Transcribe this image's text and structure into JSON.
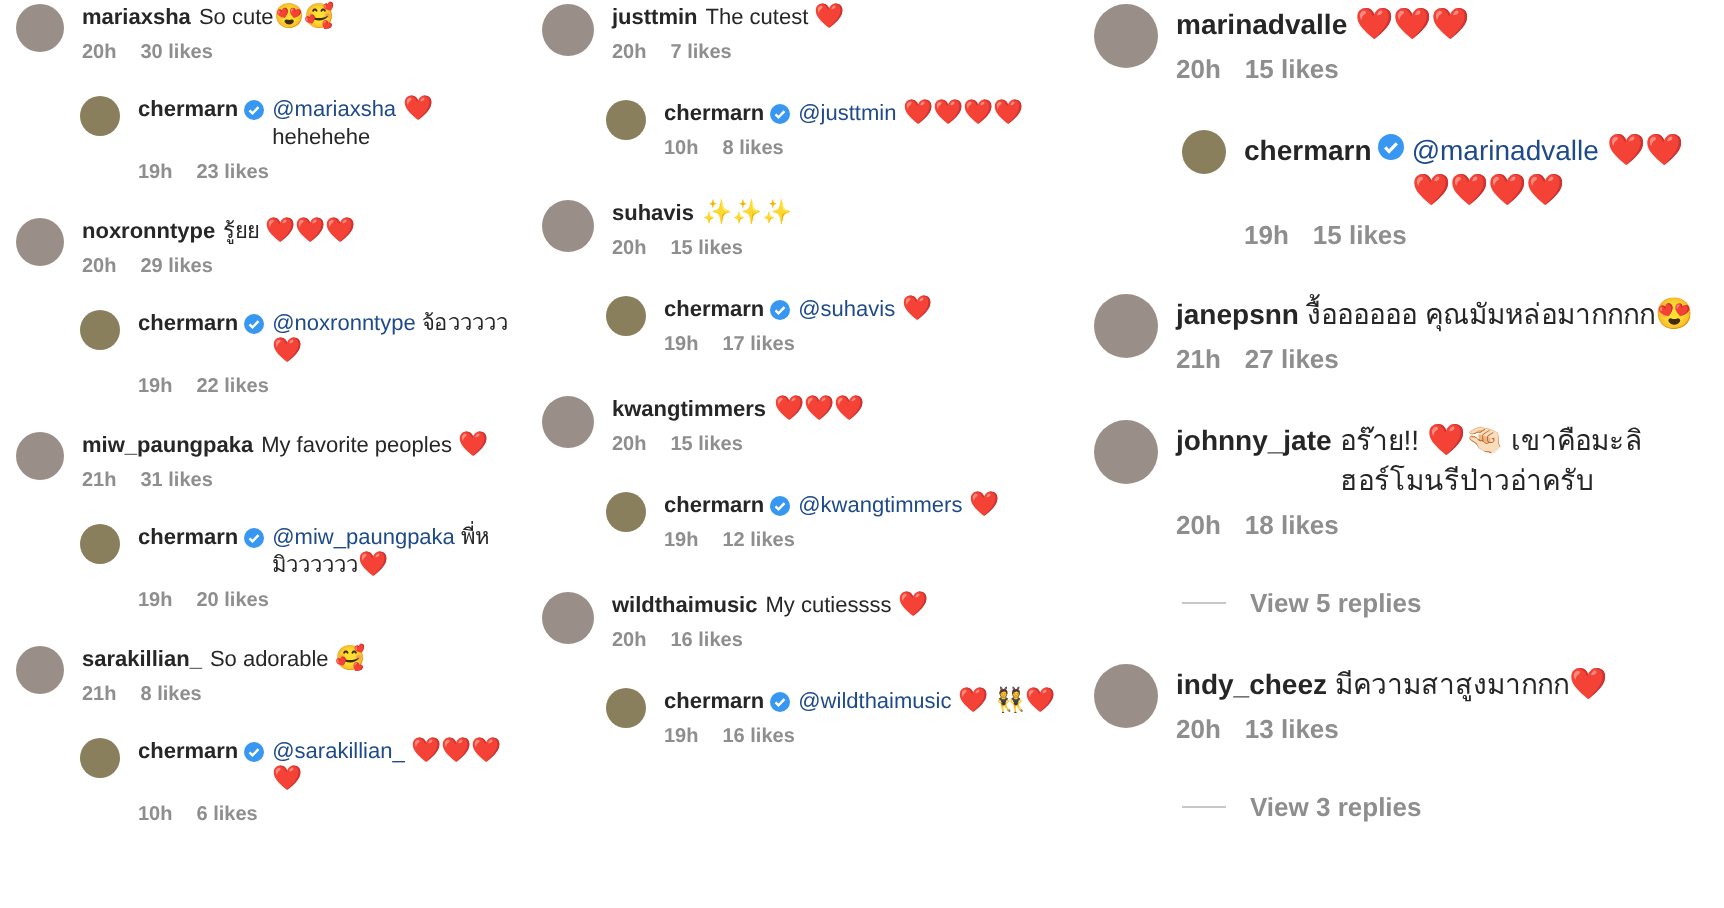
{
  "columns": [
    {
      "threads": [
        {
          "user": "mariaxsha",
          "segments": [
            {
              "kind": "text",
              "text": "So cute"
            },
            {
              "kind": "emoji",
              "text": "😍🥰"
            }
          ],
          "time": "20h",
          "likes": "30 likes",
          "reply": {
            "user": "chermarn",
            "verified": true,
            "segments": [
              {
                "kind": "mention",
                "text": "@mariaxsha"
              },
              {
                "kind": "emoji",
                "text": " ❤️"
              },
              {
                "kind": "text",
                "text": " hehehehe"
              }
            ],
            "time": "19h",
            "likes": "23 likes"
          }
        },
        {
          "user": "noxronntype",
          "segments": [
            {
              "kind": "text",
              "text": "รู้ยย "
            },
            {
              "kind": "emoji",
              "text": "❤️❤️❤️"
            }
          ],
          "time": "20h",
          "likes": "29 likes",
          "reply": {
            "user": "chermarn",
            "verified": true,
            "segments": [
              {
                "kind": "mention",
                "text": "@noxronntype"
              },
              {
                "kind": "text",
                "text": " จ้อววววว"
              },
              {
                "kind": "emoji",
                "text": " ❤️"
              }
            ],
            "time": "19h",
            "likes": "22 likes"
          }
        },
        {
          "user": "miw_paungpaka",
          "segments": [
            {
              "kind": "text",
              "text": "My favorite peoples "
            },
            {
              "kind": "emoji",
              "text": "❤️"
            }
          ],
          "time": "21h",
          "likes": "31 likes",
          "reply": {
            "user": "chermarn",
            "verified": true,
            "segments": [
              {
                "kind": "mention",
                "text": "@miw_paungpaka"
              },
              {
                "kind": "text",
                "text": " พี่หมิวววววว"
              },
              {
                "kind": "emoji",
                "text": "❤️"
              }
            ],
            "time": "19h",
            "likes": "20 likes"
          }
        },
        {
          "user": "sarakillian_",
          "segments": [
            {
              "kind": "text",
              "text": "So adorable "
            },
            {
              "kind": "emoji",
              "text": "🥰"
            }
          ],
          "time": "21h",
          "likes": "8 likes",
          "reply": {
            "user": "chermarn",
            "verified": true,
            "segments": [
              {
                "kind": "mention",
                "text": "@sarakillian_"
              },
              {
                "kind": "emoji",
                "text": " ❤️❤️❤️❤️"
              }
            ],
            "time": "10h",
            "likes": "6 likes"
          }
        }
      ]
    },
    {
      "threads": [
        {
          "user": "justtmin",
          "segments": [
            {
              "kind": "text",
              "text": "The cutest "
            },
            {
              "kind": "emoji",
              "text": "❤️"
            }
          ],
          "time": "20h",
          "likes": "7 likes",
          "reply": {
            "user": "chermarn",
            "verified": true,
            "segments": [
              {
                "kind": "mention",
                "text": "@justtmin"
              },
              {
                "kind": "emoji",
                "text": " ❤️❤️❤️❤️"
              }
            ],
            "time": "10h",
            "likes": "8 likes"
          }
        },
        {
          "user": "suhavis",
          "segments": [
            {
              "kind": "emoji",
              "text": "✨✨✨"
            }
          ],
          "time": "20h",
          "likes": "15 likes",
          "reply": {
            "user": "chermarn",
            "verified": true,
            "segments": [
              {
                "kind": "mention",
                "text": "@suhavis"
              },
              {
                "kind": "emoji",
                "text": " ❤️"
              }
            ],
            "time": "19h",
            "likes": "17 likes"
          }
        },
        {
          "user": "kwangtimmers",
          "segments": [
            {
              "kind": "emoji",
              "text": "❤️❤️❤️"
            }
          ],
          "time": "20h",
          "likes": "15 likes",
          "reply": {
            "user": "chermarn",
            "verified": true,
            "segments": [
              {
                "kind": "mention",
                "text": "@kwangtimmers"
              },
              {
                "kind": "emoji",
                "text": " ❤️"
              }
            ],
            "time": "19h",
            "likes": "12 likes"
          }
        },
        {
          "user": "wildthaimusic",
          "segments": [
            {
              "kind": "text",
              "text": "My cutiessss "
            },
            {
              "kind": "emoji",
              "text": "❤️"
            }
          ],
          "time": "20h",
          "likes": "16 likes",
          "reply": {
            "user": "chermarn",
            "verified": true,
            "segments": [
              {
                "kind": "mention",
                "text": "@wildthaimusic"
              },
              {
                "kind": "emoji",
                "text": " ❤️ 👯❤️"
              }
            ],
            "time": "19h",
            "likes": "16 likes"
          }
        }
      ]
    },
    {
      "threads": [
        {
          "user": "marinadvalle",
          "segments": [
            {
              "kind": "emoji",
              "text": "❤️❤️❤️"
            }
          ],
          "time": "20h",
          "likes": "15 likes",
          "reply": {
            "user": "chermarn",
            "verified": true,
            "segments": [
              {
                "kind": "mention",
                "text": "@marinadvalle"
              },
              {
                "kind": "emoji",
                "text": " ❤️❤️❤️❤️❤️❤️"
              }
            ],
            "time": "19h",
            "likes": "15 likes"
          }
        },
        {
          "user": "janepsnn",
          "segments": [
            {
              "kind": "text",
              "text": "งื้ออออออ คุณมัมหล่อมากกกก"
            },
            {
              "kind": "emoji",
              "text": "😍"
            }
          ],
          "time": "21h",
          "likes": "27 likes"
        },
        {
          "user": "johnny_jate",
          "segments": [
            {
              "kind": "text",
              "text": "อร๊าย!! "
            },
            {
              "kind": "emoji",
              "text": "❤️🤏🏻"
            },
            {
              "kind": "text",
              "text": " เขาคือมะลิฮอร์โมนรีป่าวอ่าครับ"
            }
          ],
          "time": "20h",
          "likes": "18 likes",
          "view_replies": "View 5 replies"
        },
        {
          "user": "indy_cheez",
          "segments": [
            {
              "kind": "text",
              "text": "มีความสาสูงมากกก"
            },
            {
              "kind": "emoji",
              "text": "❤️"
            }
          ],
          "time": "20h",
          "likes": "13 likes",
          "view_replies": "View 3 replies"
        }
      ]
    }
  ]
}
